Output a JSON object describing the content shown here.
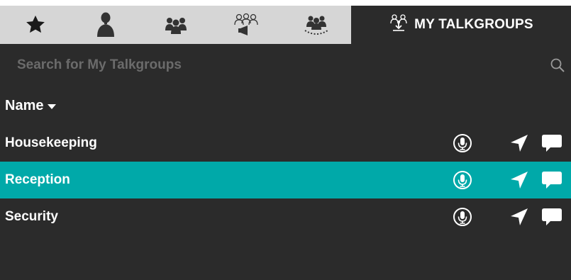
{
  "tabs": {
    "icons": [
      "star-icon",
      "person-icon",
      "group-icon",
      "broadcast-group-icon",
      "dispatch-group-icon"
    ],
    "active_label": "MY TALKGROUPS",
    "active_icon": "talkgroup-download-icon"
  },
  "search": {
    "placeholder": "Search for My Talkgroups",
    "value": ""
  },
  "list": {
    "header": "Name",
    "sort": "descending",
    "rows": [
      {
        "name": "Housekeeping",
        "selected": false
      },
      {
        "name": "Reception",
        "selected": true
      },
      {
        "name": "Security",
        "selected": false
      }
    ]
  },
  "colors": {
    "background": "#2b2b2b",
    "tabbar": "#d6d6d6",
    "selected_row": "#00a9a9",
    "text": "#ffffff"
  }
}
